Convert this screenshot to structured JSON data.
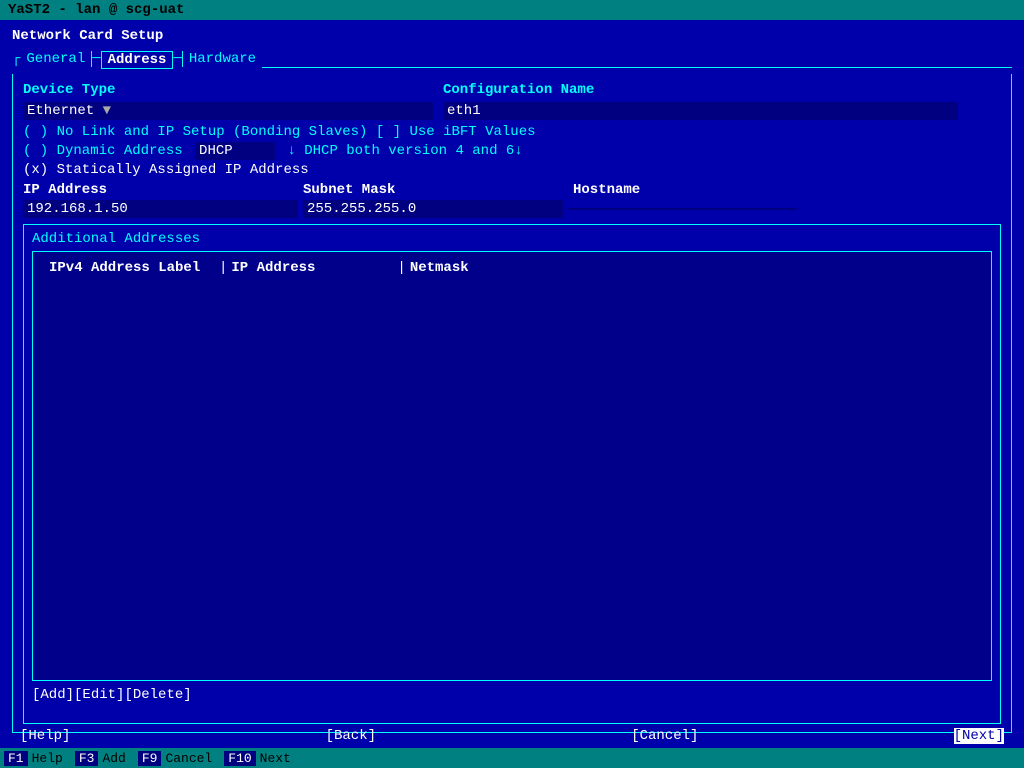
{
  "titlebar": {
    "text": "YaST2 - lan @ scg-uat"
  },
  "window": {
    "title": "Network Card Setup"
  },
  "tabs": {
    "items": [
      {
        "label": "General",
        "active": false
      },
      {
        "label": "Address",
        "active": true
      },
      {
        "label": "Hardware",
        "active": false
      }
    ]
  },
  "form": {
    "device_type_label": "Device Type",
    "config_name_label": "Configuration Name",
    "device_type_value": "Ethernet",
    "config_name_value": "eth1",
    "radio_options": [
      {
        "label": "( ) No Link and IP Setup (Bonding Slaves)",
        "bracket_label": "[ ]",
        "use_label": "Use iBFT Values"
      },
      {
        "label": "( ) Dynamic Address",
        "dhcp_value": "DHCP",
        "dhcp_desc": "↓ DHCP both version 4 and 6↓"
      },
      {
        "label": "(x) Statically Assigned IP Address"
      }
    ],
    "ip_label": "IP Address",
    "subnet_label": "Subnet Mask",
    "hostname_label": "Hostname",
    "ip_value": "192.168.1.50",
    "subnet_value": "255.255.255.0",
    "hostname_value": ""
  },
  "additional_addresses": {
    "section_title": "Additional Addresses",
    "table_headers": [
      {
        "label": "IPv4 Address Label"
      },
      {
        "label": "IP Address"
      },
      {
        "label": "Netmask"
      }
    ],
    "rows": []
  },
  "action_buttons": {
    "add": "[Add]",
    "edit": "[Edit]",
    "delete": "[Delete]"
  },
  "bottom_nav": {
    "help": "[Help]",
    "back": "[Back]",
    "cancel": "[Cancel]",
    "next": "[Next]"
  },
  "function_keys": [
    {
      "key": "F1",
      "label": "Help"
    },
    {
      "key": "F3",
      "label": "Add"
    },
    {
      "key": "F9",
      "label": "Cancel"
    },
    {
      "key": "F10",
      "label": "Next"
    }
  ]
}
